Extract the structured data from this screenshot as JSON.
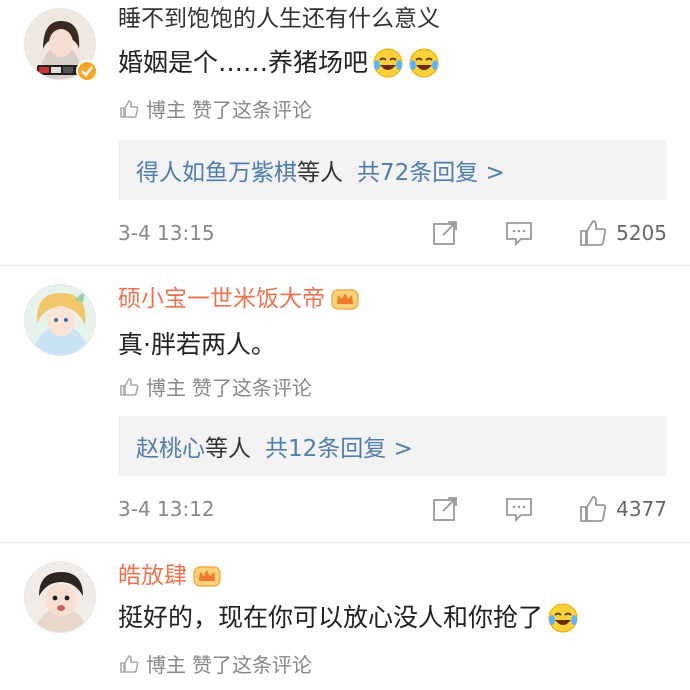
{
  "comments": [
    {
      "username": "睡不到饱饱的人生还有什么意义",
      "text": "婚姻是个……养猪场吧",
      "emojis": [
        "laugh-cry-emoji",
        "laugh-cry-emoji"
      ],
      "liked_by": "博主",
      "liked_text": "赞了这条评论",
      "reply_names": "得人如鱼万紫棋",
      "reply_etc": "等人",
      "reply_count": "共72条回复 >",
      "time": "3-4 13:15",
      "likes": "5205"
    },
    {
      "username": "硕小宝一世米饭大帝",
      "text": "真·胖若两人。",
      "liked_by": "博主",
      "liked_text": "赞了这条评论",
      "reply_names": "赵桃心",
      "reply_etc": "等人",
      "reply_count": "共12条回复 >",
      "time": "3-4 13:12",
      "likes": "4377"
    },
    {
      "username": "皓放肆",
      "text": "挺好的，现在你可以放心没人和你抢了",
      "emojis": [
        "laugh-cry-emoji"
      ],
      "liked_by": "博主",
      "liked_text": "赞了这条评论"
    }
  ],
  "colors": {
    "member_name": "#eb7350",
    "link_blue": "#507daf",
    "reply_bg": "#f3f3f3",
    "muted": "#888888"
  }
}
